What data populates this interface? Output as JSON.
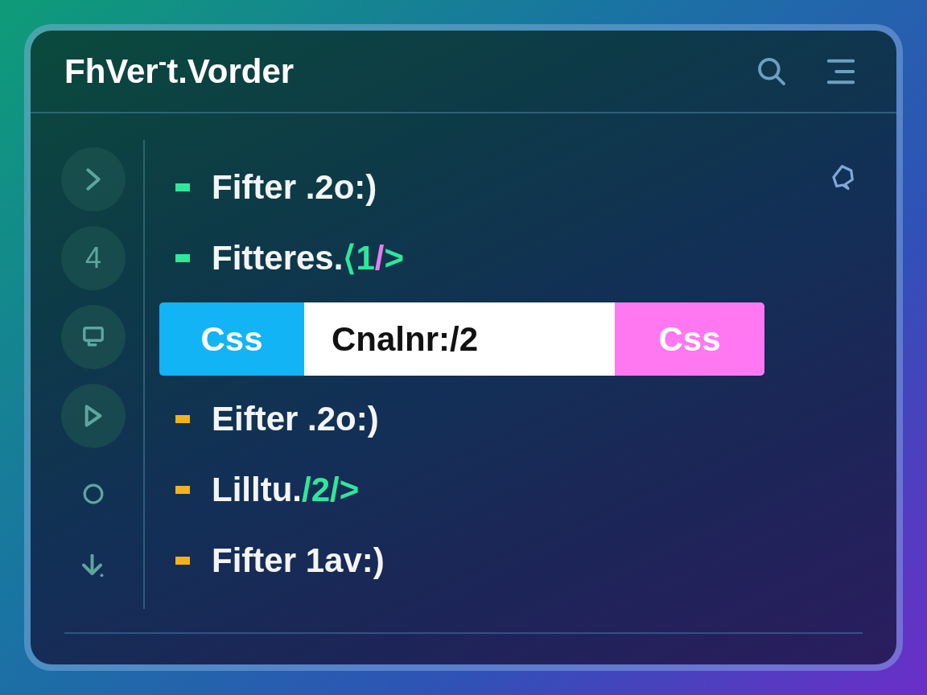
{
  "window": {
    "title": "FhVer$^{-}$t.Vorder"
  },
  "rail": {
    "buttons": [
      {
        "kind": "icon"
      },
      {
        "kind": "text",
        "label": "4"
      },
      {
        "kind": "icon"
      },
      {
        "kind": "icon"
      }
    ],
    "tools": [
      {
        "kind": "icon"
      },
      {
        "kind": "icon"
      }
    ]
  },
  "list": {
    "items": [
      {
        "kind": "row",
        "color": "#2ee89a",
        "segments": [
          {
            "kind": "plain",
            "text": "Fifter .2o:)"
          }
        ]
      },
      {
        "kind": "row",
        "color": "#2ee89a",
        "segments": [
          {
            "kind": "plain",
            "text": "Fitteres."
          },
          {
            "kind": "code",
            "text": "⟨1"
          },
          {
            "kind": "mark",
            "text": "/"
          },
          {
            "kind": "code",
            "text": ">"
          }
        ]
      },
      {
        "kind": "bar",
        "cells": [
          {
            "kind": "tag",
            "text": "Css",
            "color": "#12b4f6"
          },
          {
            "kind": "value",
            "text": "Cnalnr:/2",
            "color": "#ffffff"
          },
          {
            "kind": "tag",
            "text": "Css",
            "color": "#ff78f2"
          }
        ]
      },
      {
        "kind": "row",
        "color": "#f5b021",
        "segments": [
          {
            "kind": "plain",
            "text": "Eifter .2o:)"
          }
        ]
      },
      {
        "kind": "row",
        "color": "#f5b021",
        "segments": [
          {
            "kind": "plain",
            "text": "Lilltu."
          },
          {
            "kind": "code",
            "text": "/2/>"
          }
        ]
      },
      {
        "kind": "row",
        "color": "#f5b021",
        "segments": [
          {
            "kind": "plain",
            "text": "Fifter 1av:)"
          }
        ]
      }
    ]
  }
}
